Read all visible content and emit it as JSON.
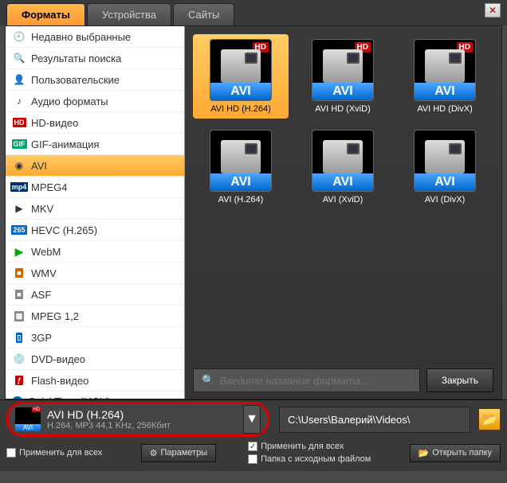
{
  "tabs": {
    "formats": "Форматы",
    "devices": "Устройства",
    "sites": "Сайты"
  },
  "sidebar": [
    {
      "label": "Недавно выбранные",
      "icon": "🕘"
    },
    {
      "label": "Результаты поиска",
      "icon": "🔍"
    },
    {
      "label": "Пользовательские",
      "icon": "👤"
    },
    {
      "label": "Аудио форматы",
      "icon": "♪"
    },
    {
      "label": "HD-видео",
      "badge": "HD",
      "bclass": "b-hd"
    },
    {
      "label": "GIF-анимация",
      "badge": "GIF",
      "bclass": "b-gif"
    },
    {
      "label": "AVI",
      "icon": "◉",
      "selected": true
    },
    {
      "label": "MPEG4",
      "badge": "mp4",
      "bclass": "b-mp4"
    },
    {
      "label": "MKV",
      "icon": "▶"
    },
    {
      "label": "HEVC (H.265)",
      "badge": "265",
      "bclass": "b-265"
    },
    {
      "label": "WebM",
      "icon": "▶",
      "iclass": "b-play"
    },
    {
      "label": "WMV",
      "badge": "■",
      "bclass": "b-wmv"
    },
    {
      "label": "ASF",
      "badge": "■",
      "bclass": "b-asf"
    },
    {
      "label": "MPEG 1,2",
      "badge": "▦",
      "bclass": "b-mpg"
    },
    {
      "label": "3GP",
      "badge": "▯",
      "bclass": "b-3gp"
    },
    {
      "label": "DVD-видео",
      "icon": "💿"
    },
    {
      "label": "Flash-видео",
      "badge": "ƒ",
      "bclass": "b-fl"
    },
    {
      "label": "QuickTime (MOV)",
      "icon": "Q",
      "iclass": "b-qt"
    }
  ],
  "formats": [
    {
      "band": "AVI",
      "caption": "AVI HD (H.264)",
      "hd": true,
      "selected": true
    },
    {
      "band": "AVI",
      "caption": "AVI HD (XviD)",
      "hd": true
    },
    {
      "band": "AVI",
      "caption": "AVI HD (DivX)",
      "hd": true
    },
    {
      "band": "AVI",
      "caption": "AVI (H.264)",
      "hd": false
    },
    {
      "band": "AVI",
      "caption": "AVI (XviD)",
      "hd": false
    },
    {
      "band": "AVI",
      "caption": "AVI (DivX)",
      "hd": false
    }
  ],
  "search": {
    "placeholder": "Введите название формата..."
  },
  "close_panel": "Закрыть",
  "selected": {
    "title": "AVI HD (H.264)",
    "sub": "H.264, MP3\n44,1 KHz, 256Кбит",
    "band": "AVI",
    "hd": "HD"
  },
  "output_path": "C:\\Users\\Валерий\\Videos\\",
  "footer": {
    "apply_all_left": "Применить для всех",
    "params": "Параметры",
    "apply_all_right": "Применить для всех",
    "source_folder": "Папка с исходным файлом",
    "open_folder": "Открыть папку"
  }
}
